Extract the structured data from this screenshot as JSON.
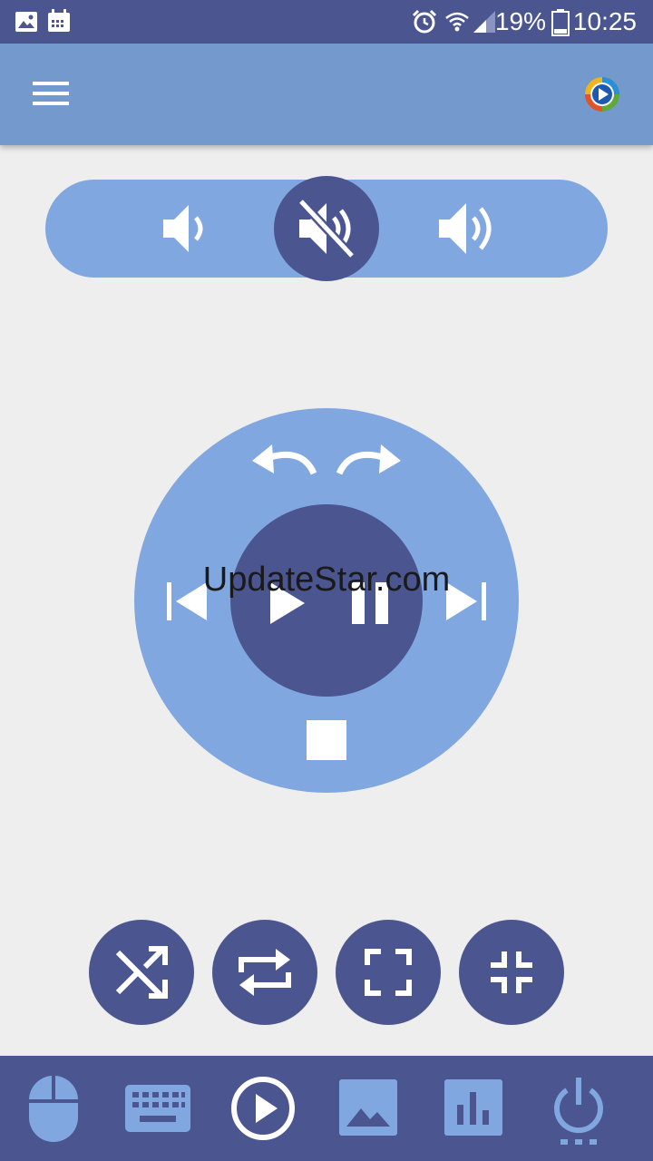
{
  "status_bar": {
    "battery_percent": "19%",
    "time": "10:25",
    "icons": [
      "gallery-icon",
      "calendar-icon",
      "alarm-icon",
      "wifi-icon",
      "signal-icon",
      "battery-icon"
    ]
  },
  "app_bar": {
    "menu_icon": "hamburger-menu-icon",
    "app_logo_icon": "media-player-logo-icon"
  },
  "volume": {
    "buttons": [
      "volume-down",
      "mute",
      "volume-up"
    ]
  },
  "transport": {
    "buttons": [
      "rewind",
      "fast-forward",
      "previous",
      "play",
      "pause",
      "next",
      "stop"
    ]
  },
  "options": {
    "buttons": [
      "shuffle",
      "repeat",
      "fullscreen",
      "exit-fullscreen"
    ]
  },
  "bottom_nav": {
    "items": [
      "mouse",
      "keyboard",
      "media",
      "image",
      "stats",
      "power"
    ]
  },
  "watermark": "UpdateStar.com",
  "colors": {
    "status_bar": "#4b5590",
    "app_bar": "#7499cd",
    "accent_dark": "#4b5590",
    "accent_light": "#80a7e0",
    "background": "#eeeeee"
  }
}
